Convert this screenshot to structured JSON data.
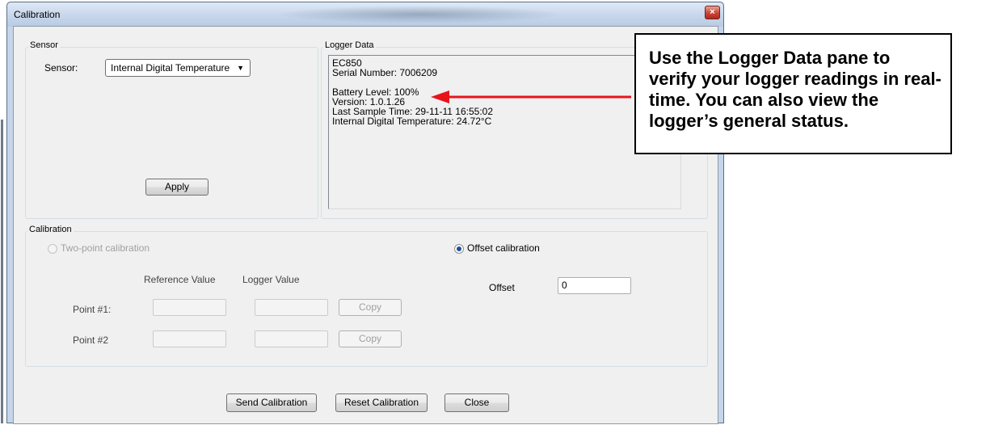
{
  "window": {
    "title": "Calibration",
    "close_glyph": "×"
  },
  "sensor_group": {
    "label": "Sensor",
    "sensor_label": "Sensor:",
    "sensor_value": "Internal Digital Temperature",
    "apply_label": "Apply"
  },
  "logger_group": {
    "label": "Logger Data",
    "lines": [
      "EC850",
      "Serial Number: 7006209",
      "",
      "Battery Level: 100%",
      "Version: 1.0.1.26",
      "Last Sample Time:  29-11-11 16:55:02",
      "Internal Digital Temperature: 24.72°C"
    ]
  },
  "calibration_group": {
    "label": "Calibration",
    "two_point_label": "Two-point calibration",
    "offset_radio_label": "Offset calibration",
    "reference_header": "Reference Value",
    "logger_header": "Logger Value",
    "point1_label": "Point #1:",
    "point2_label": "Point #2",
    "copy_label": "Copy",
    "offset_label": "Offset",
    "offset_value": "0"
  },
  "footer": {
    "send_label": "Send Calibration",
    "reset_label": "Reset Calibration",
    "close_label": "Close"
  },
  "callout": {
    "text": "Use the Logger Data pane to verify your logger readings in real-time. You can also view the logger’s general status."
  },
  "colors": {
    "arrow": "#e8141b"
  }
}
